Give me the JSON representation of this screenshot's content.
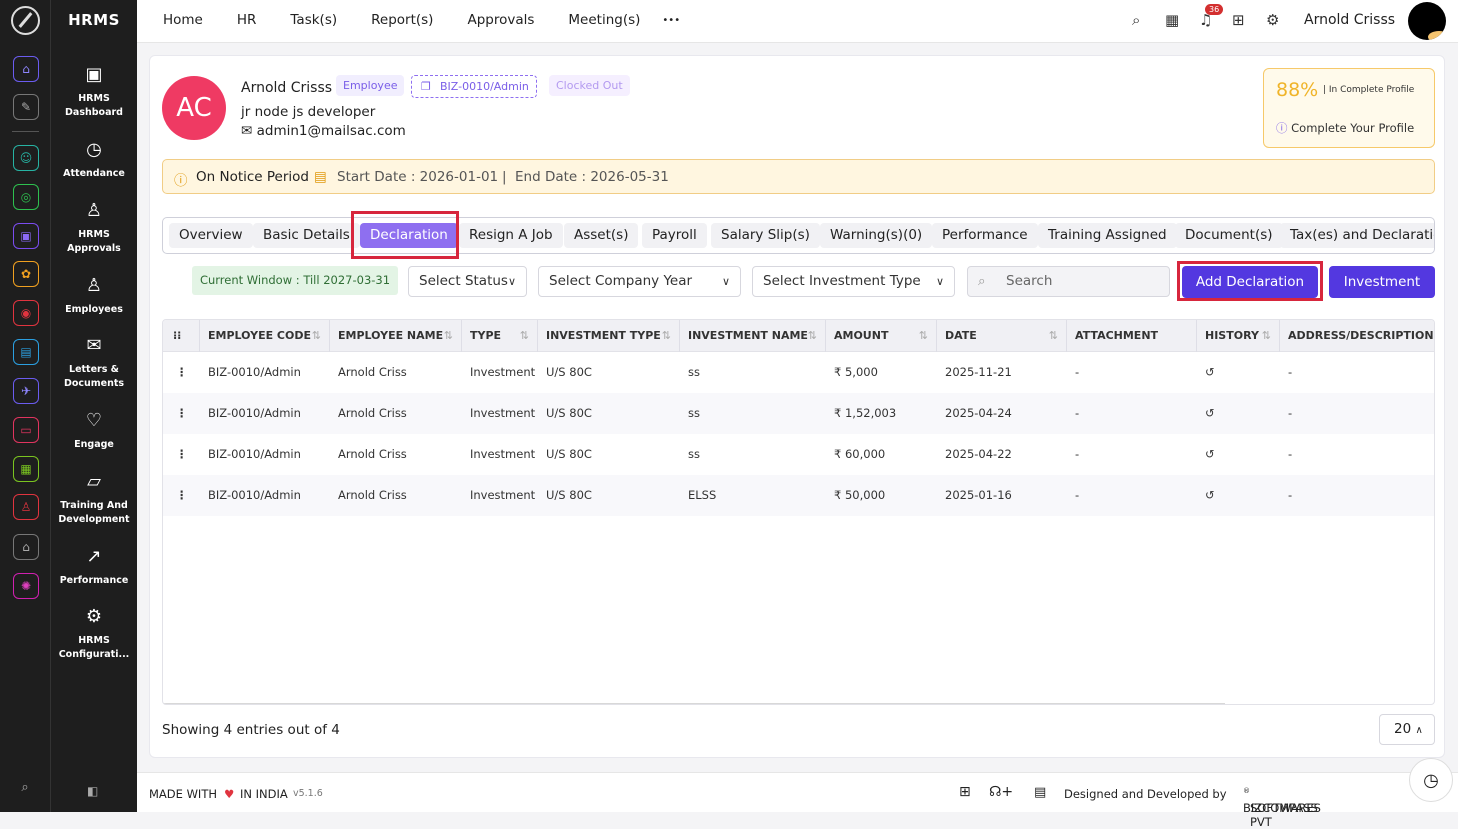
{
  "brand": "HRMS",
  "sidebar": [
    {
      "icon": "dashboard-icon",
      "label": "HRMS Dashboard"
    },
    {
      "icon": "attendance-icon",
      "label": "Attendance"
    },
    {
      "icon": "approvals-icon",
      "label": "HRMS Approvals"
    },
    {
      "icon": "employees-icon",
      "label": "Employees"
    },
    {
      "icon": "letters-icon",
      "label": "Letters & Documents"
    },
    {
      "icon": "engage-icon",
      "label": "Engage"
    },
    {
      "icon": "training-icon",
      "label": "Training And Development"
    },
    {
      "icon": "performance-icon",
      "label": "Performance"
    },
    {
      "icon": "config-icon",
      "label": "HRMS Configurati..."
    }
  ],
  "topnav": [
    "Home",
    "HR",
    "Task(s)",
    "Report(s)",
    "Approvals",
    "Meeting(s)"
  ],
  "more": "•••",
  "notif_count": "36",
  "user_name": "Arnold Crisss",
  "profile": {
    "initials": "AC",
    "name": "Arnold Crisss",
    "role_tag": "Employee",
    "code_tag": "BIZ-0010/Admin",
    "status_tag": "Clocked Out",
    "designation": "jr node js developer",
    "email": "admin1@mailsac.com",
    "completion_pct": "88%",
    "completion_sub": "| In Complete Profile",
    "complete_cta": "Complete Your Profile"
  },
  "notice": {
    "label": "On Notice Period",
    "start": "Start Date : 2026-01-01",
    "sep": "|",
    "end": "End Date : 2026-05-31"
  },
  "tabs": [
    "Overview",
    "Basic Details",
    "Declaration",
    "Resign A Job",
    "Asset(s)",
    "Payroll",
    "Salary Slip(s)",
    "Warning(s)(0)",
    "Performance",
    "Training Assigned",
    "Document(s)",
    "Tax(es) and Declaration"
  ],
  "active_tab": "Declaration",
  "filters": {
    "window": "Current Window : Till 2027-03-31",
    "status": "Select Status",
    "year": "Select Company Year",
    "investment_type": "Select Investment Type",
    "search_placeholder": "Search",
    "add_btn": "Add Declaration",
    "invest_btn": "Investment"
  },
  "columns": [
    "EMPLOYEE CODE",
    "EMPLOYEE NAME",
    "TYPE",
    "INVESTMENT TYPE",
    "INVESTMENT NAME",
    "AMOUNT",
    "DATE",
    "ATTACHMENT",
    "HISTORY",
    "ADDRESS/DESCRIPTION"
  ],
  "rows": [
    {
      "code": "BIZ-0010/Admin",
      "name": "Arnold Criss",
      "type": "Investment",
      "inv_type": "U/S 80C",
      "inv_name": "ss",
      "amount": "₹ 5,000",
      "date": "2025-11-21",
      "attachment": "-",
      "address": "-"
    },
    {
      "code": "BIZ-0010/Admin",
      "name": "Arnold Criss",
      "type": "Investment",
      "inv_type": "U/S 80C",
      "inv_name": "ss",
      "amount": "₹ 1,52,003",
      "date": "2025-04-24",
      "attachment": "-",
      "address": "-"
    },
    {
      "code": "BIZ-0010/Admin",
      "name": "Arnold Criss",
      "type": "Investment",
      "inv_type": "U/S 80C",
      "inv_name": "ss",
      "amount": "₹ 60,000",
      "date": "2025-04-22",
      "attachment": "-",
      "address": "-"
    },
    {
      "code": "BIZ-0010/Admin",
      "name": "Arnold Criss",
      "type": "Investment",
      "inv_type": "U/S 80C",
      "inv_name": "ELSS",
      "amount": "₹ 50,000",
      "date": "2025-01-16",
      "attachment": "-",
      "address": "-"
    }
  ],
  "entries_text": "Showing 4 entries out of 4",
  "page_size": "20",
  "footer": {
    "made": "MADE WITH",
    "india": "IN INDIA",
    "version": "v5.1.6",
    "designed": "Designed and Developed by",
    "company": "BIZCOMPASS",
    "reg": "®",
    "company_rest": "SOFTWARES PVT"
  },
  "colors": {
    "accent": "#5338e0",
    "tab_active": "#8e6ff0",
    "avatar": "#ef3a63",
    "highlight": "#d7263d"
  }
}
